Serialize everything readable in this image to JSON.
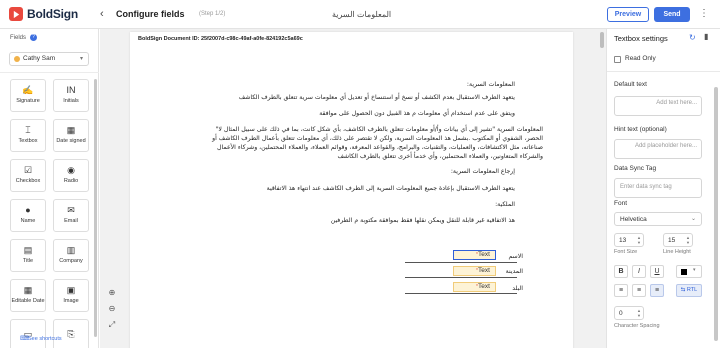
{
  "header": {
    "logo_text": "BoldSign",
    "title": "Configure fields",
    "step": "(Step 1/2)",
    "document_name": "المعلومات السرية",
    "preview_label": "Preview",
    "send_label": "Send",
    "colors": {
      "brand_red": "#e9493e",
      "accent_blue": "#3d6fe0"
    }
  },
  "left_panel": {
    "fields_label": "Fields",
    "signer": "Cathy Sam",
    "tiles": [
      {
        "label": "Signature",
        "icon": "signature-icon",
        "glyph": "✍"
      },
      {
        "label": "Initials",
        "icon": "initials-icon",
        "glyph": "IN"
      },
      {
        "label": "Textbox",
        "icon": "textbox-icon",
        "glyph": "⌶"
      },
      {
        "label": "Date signed",
        "icon": "calendar-icon",
        "glyph": "▦"
      },
      {
        "label": "Checkbox",
        "icon": "checkbox-icon",
        "glyph": "☑"
      },
      {
        "label": "Radio",
        "icon": "radio-icon",
        "glyph": "◉"
      },
      {
        "label": "Name",
        "icon": "person-icon",
        "glyph": "●"
      },
      {
        "label": "Email",
        "icon": "email-icon",
        "glyph": "✉"
      },
      {
        "label": "Title",
        "icon": "title-icon",
        "glyph": "▤"
      },
      {
        "label": "Company",
        "icon": "company-icon",
        "glyph": "▥"
      },
      {
        "label": "Editable Date",
        "icon": "editable-date-icon",
        "glyph": "▦"
      },
      {
        "label": "Image",
        "icon": "image-icon",
        "glyph": "▣"
      },
      {
        "label": "",
        "icon": "label-icon",
        "glyph": "▭"
      },
      {
        "label": "",
        "icon": "attachment-icon",
        "glyph": "⎘"
      }
    ],
    "shortcuts_label": "See shortcuts"
  },
  "document": {
    "doc_id": "BoldSign Document ID: 25f2007d-c98c-49af-a0fe-824192c5a69c",
    "lines": [
      "المعلومات السرية:",
      "يتعهد الطرف الاستقبال بعدم الكشف أو نسخ أو استنساخ أو تعديل أي معلومات سرية تتعلق بالطرف الكاشف",
      "ويتفق على عدم استخدام أي معلومات  م  هذ الفبيل دون الحصول على موافقة",
      "المعلومات السرية \"تشير إلى أي بيانات وأ/أو معلومات تتعلق بالطرف الكاشف، بأي شكل كانت، بما في ذلك على سبيل المثال لا\"",
      "الحصر، الشفوي أو المكتوب .بشمل  هذ المعلومات السرية، ولكن لا تقتصر على ذلك، أي معلومات تتعلق بأعمال الطرف الكاشف أو",
      "صناعاته، مثل الاكتشافات، والعمليات، والتقنيات، والبرامج، والقواعد المعرفة، وقوائم العملاء، والعملاء المحتملين، وشركاء الأعمال",
      "والشركاء المتعاونين، والعملاء المحتملين، وأي   خدمأ أخرى تتعلق بالطرف الكاشف",
      "إرجاع المعلومات السرية:",
      "يتعهد الطرف الاستقبال بإعادة جميع المعلومات السرية إلى الطرف الكاشف عند انتهاء  هذ الاتفاقية",
      "الملكية:",
      "هذ  الاتفاقية غير قابلة للنقل ويمكن نقلها فقط بموافقة مكتوبة  م  الطرفين"
    ],
    "form_labels": [
      "الاسم",
      "المدينة",
      "البلد"
    ],
    "text_field_label": "Text",
    "zoom_in": "⊕",
    "zoom_out": "⊖",
    "fit": "⤢"
  },
  "settings": {
    "title": "Textbox settings",
    "read_only_label": "Read Only",
    "default_text_label": "Default text",
    "default_text_placeholder": "Add text here...",
    "hint_text_label": "Hint text (optional)",
    "hint_text_placeholder": "Add placeholder here...",
    "data_sync_label": "Data Sync Tag",
    "data_sync_placeholder": "Enter data sync tag",
    "font_label": "Font",
    "font_value": "Helvetica",
    "font_size": "13",
    "line_height": "15",
    "font_size_label": "Font Size",
    "line_height_label": "Line Height",
    "bold": "B",
    "italic": "I",
    "underline": "U",
    "font_color": "#000000",
    "rtl_label": "RTL",
    "character_spacing": "0",
    "character_spacing_label": "Character Spacing"
  }
}
